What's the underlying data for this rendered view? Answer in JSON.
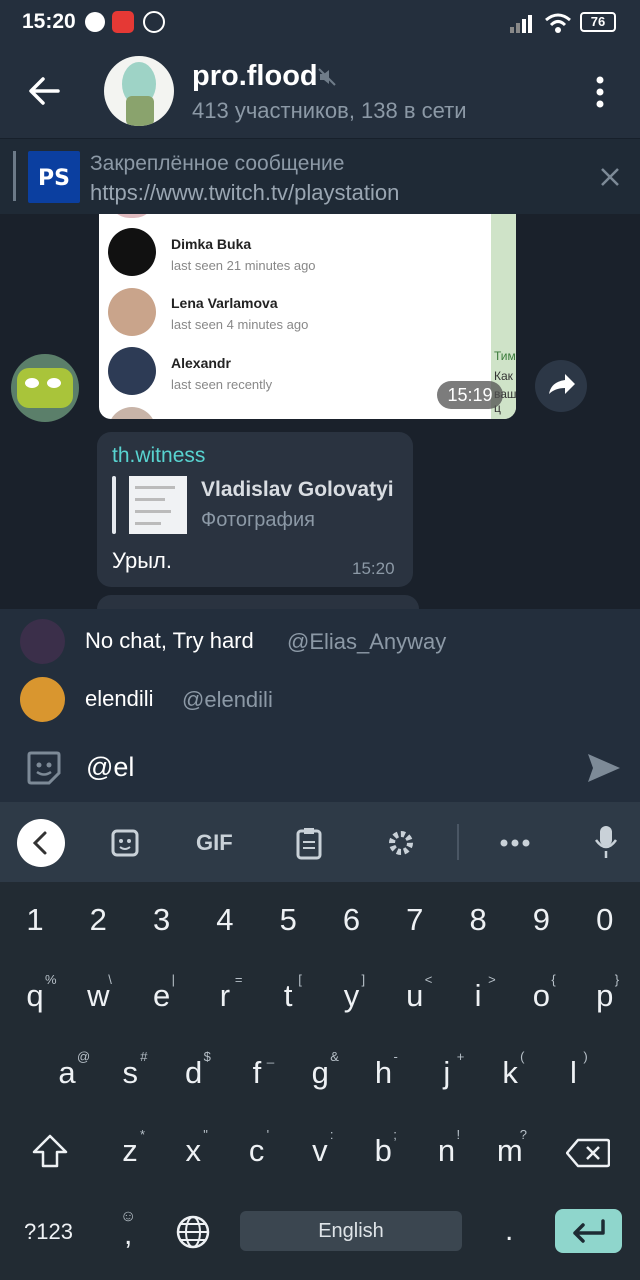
{
  "status_bar": {
    "time": "15:20",
    "battery": "76"
  },
  "header": {
    "title": "pro.flood",
    "subtitle": "413 участников, 138 в сети"
  },
  "pinned": {
    "label": "Закреплённое сообщение",
    "text": "https://www.twitch.tv/playstation"
  },
  "chat": {
    "photo_rows": [
      {
        "name": "Dimka Buka",
        "status": "last seen 21 minutes ago"
      },
      {
        "name": "Lena Varlamova",
        "status": "last seen 4 minutes ago"
      },
      {
        "name": "Alexandr",
        "status": "last seen recently"
      }
    ],
    "photo_time": "15:19",
    "photo_side_text": [
      "Тим",
      "Как",
      "ваш ц"
    ],
    "reply": {
      "author": "th.witness",
      "quoted_name": "Vladislav Golovatyi",
      "quoted_type": "Фотография",
      "text": "Урыл.",
      "time": "15:20"
    }
  },
  "mentions": [
    {
      "name": "No chat, Try hard",
      "username": "@Elias_Anyway"
    },
    {
      "name": "elendili",
      "username": "@elendili"
    }
  ],
  "input": {
    "value": "@el"
  },
  "keyboard": {
    "toolbar": [
      "back",
      "sticker",
      "GIF",
      "clipboard",
      "settings",
      "more",
      "mic"
    ],
    "gif_label": "GIF",
    "numbers": [
      "1",
      "2",
      "3",
      "4",
      "5",
      "6",
      "7",
      "8",
      "9",
      "0"
    ],
    "row1": [
      "q",
      "w",
      "e",
      "r",
      "t",
      "y",
      "u",
      "i",
      "o",
      "p"
    ],
    "row1_sup": [
      "%",
      "\\",
      "|",
      "=",
      "[",
      "]",
      "<",
      ">",
      "{",
      "}"
    ],
    "row2": [
      "a",
      "s",
      "d",
      "f",
      "g",
      "h",
      "j",
      "k",
      "l"
    ],
    "row2_sup": [
      "@",
      "#",
      "$",
      "_",
      "&",
      "-",
      "+",
      "(",
      ")"
    ],
    "row3": [
      "z",
      "x",
      "c",
      "v",
      "b",
      "n",
      "m"
    ],
    "row3_sup": [
      "*",
      "\"",
      "'",
      ":",
      ";",
      "!",
      "?"
    ],
    "sym_label": "?123",
    "comma": ",",
    "period": ".",
    "space_label": "English"
  },
  "colors": {
    "accent": "#58d3d0",
    "enter_key": "#8fd6cc",
    "background": "#1d2733"
  }
}
